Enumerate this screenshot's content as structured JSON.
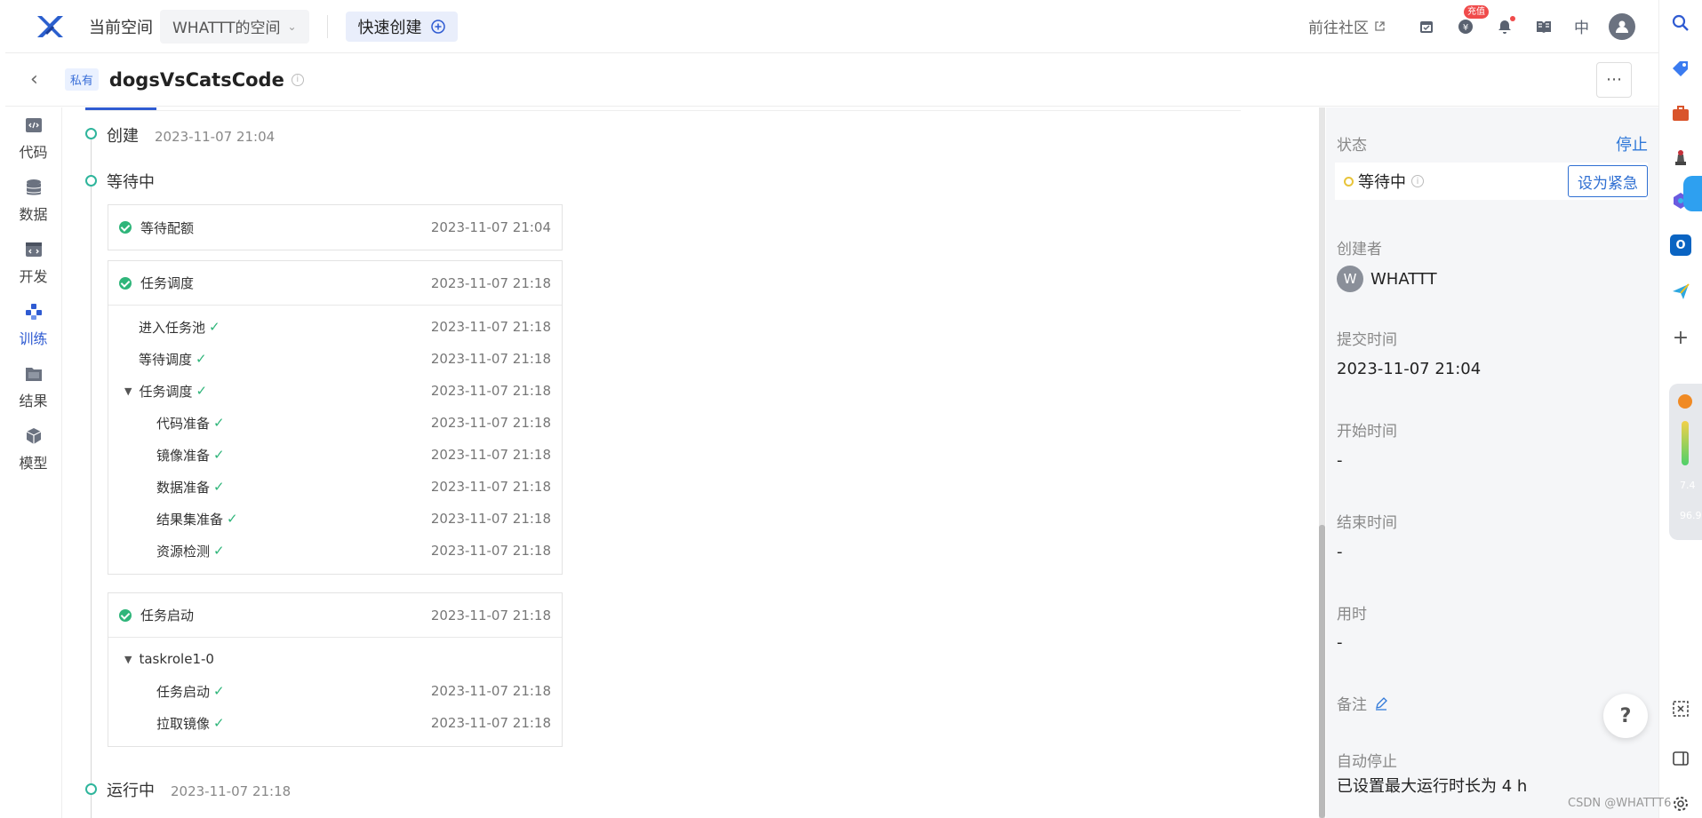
{
  "topbar": {
    "space_label": "当前空间",
    "space_value": "WHATTT的空间",
    "quick_create": "快速创建",
    "community": "前往社区",
    "recharge_badge": "充值",
    "lang": "中"
  },
  "subheader": {
    "private_tag": "私有",
    "title": "dogsVsCatsCode"
  },
  "nav": [
    {
      "label": "代码",
      "icon": "code-icon"
    },
    {
      "label": "数据",
      "icon": "database-icon"
    },
    {
      "label": "开发",
      "icon": "dev-icon"
    },
    {
      "label": "训练",
      "icon": "train-icon"
    },
    {
      "label": "结果",
      "icon": "folder-icon"
    },
    {
      "label": "模型",
      "icon": "cube-icon"
    }
  ],
  "timeline": {
    "created": {
      "label": "创建",
      "time": "2023-11-07 21:04"
    },
    "waiting": {
      "label": "等待中"
    },
    "running": {
      "label": "运行中",
      "time": "2023-11-07 21:18"
    },
    "quota": {
      "label": "等待配额",
      "time": "2023-11-07 21:04"
    },
    "schedule": {
      "label": "任务调度",
      "time": "2023-11-07 21:18",
      "rows": [
        {
          "label": "进入任务池",
          "time": "2023-11-07 21:18"
        },
        {
          "label": "等待调度",
          "time": "2023-11-07 21:18"
        },
        {
          "label": "任务调度",
          "time": "2023-11-07 21:18"
        },
        {
          "label": "代码准备",
          "time": "2023-11-07 21:18"
        },
        {
          "label": "镜像准备",
          "time": "2023-11-07 21:18"
        },
        {
          "label": "数据准备",
          "time": "2023-11-07 21:18"
        },
        {
          "label": "结果集准备",
          "time": "2023-11-07 21:18"
        },
        {
          "label": "资源检测",
          "time": "2023-11-07 21:18"
        }
      ]
    },
    "start": {
      "label": "任务启动",
      "time": "2023-11-07 21:18",
      "group": "taskrole1-0",
      "rows": [
        {
          "label": "任务启动",
          "time": "2023-11-07 21:18"
        },
        {
          "label": "拉取镜像",
          "time": "2023-11-07 21:18"
        }
      ]
    }
  },
  "panel": {
    "status_label": "状态",
    "stop": "停止",
    "status_value": "等待中",
    "urgent": "设为紧急",
    "creator_label": "创建者",
    "creator_initial": "W",
    "creator_name": "WHATTT",
    "submit_label": "提交时间",
    "submit_value": "2023-11-07 21:04",
    "start_label": "开始时间",
    "start_value": "-",
    "end_label": "结束时间",
    "end_value": "-",
    "duration_label": "用时",
    "duration_value": "-",
    "remark_label": "备注",
    "autostop_label": "自动停止",
    "autostop_value": "已设置最大运行时长为 4 h"
  },
  "help": "?",
  "speed": {
    "up": "7.4",
    "down": "96.9"
  },
  "watermark": "CSDN @WHATTT6",
  "colors": {
    "accent": "#2f5bd2",
    "success": "#2fb57a",
    "timeline": "#2fb59c"
  }
}
